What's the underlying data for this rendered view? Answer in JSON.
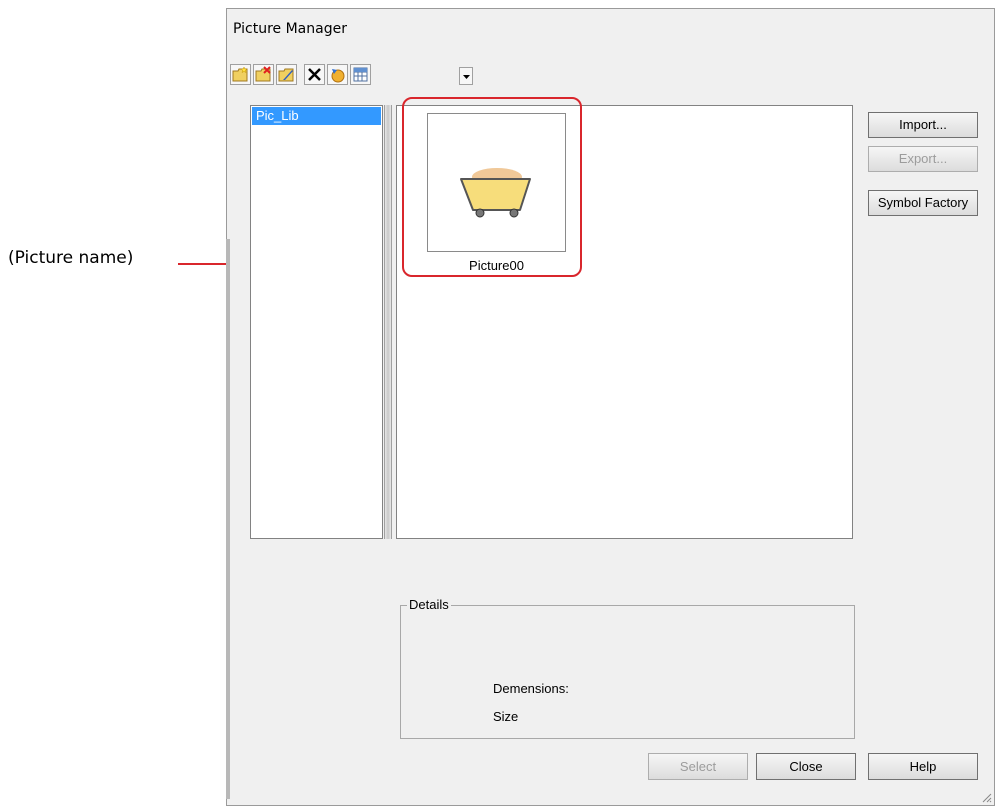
{
  "annotation": {
    "label": "(Picture name)"
  },
  "dialog": {
    "title": "Picture Manager"
  },
  "toolbar": {
    "buttons": [
      {
        "icon": "new-folder-icon"
      },
      {
        "icon": "delete-folder-icon"
      },
      {
        "icon": "rename-folder-icon"
      },
      {
        "icon": "delete-icon"
      },
      {
        "icon": "refresh-icon"
      },
      {
        "icon": "view-icon"
      }
    ]
  },
  "tree": {
    "items": [
      {
        "label": "Pic_Lib",
        "selected": true
      }
    ]
  },
  "pictures": {
    "items": [
      {
        "name": "Picture00"
      }
    ]
  },
  "side_buttons": {
    "import": "Import...",
    "export": "Export...",
    "symbol_factory": "Symbol Factory"
  },
  "details": {
    "legend": "Details",
    "dimensions_label": "Demensions:",
    "size_label": "Size"
  },
  "bottom_buttons": {
    "select": "Select",
    "close": "Close",
    "help": "Help"
  },
  "colors": {
    "annotation": "#d9262c",
    "selection": "#3399ff",
    "dialog_bg": "#f0f0f0"
  }
}
